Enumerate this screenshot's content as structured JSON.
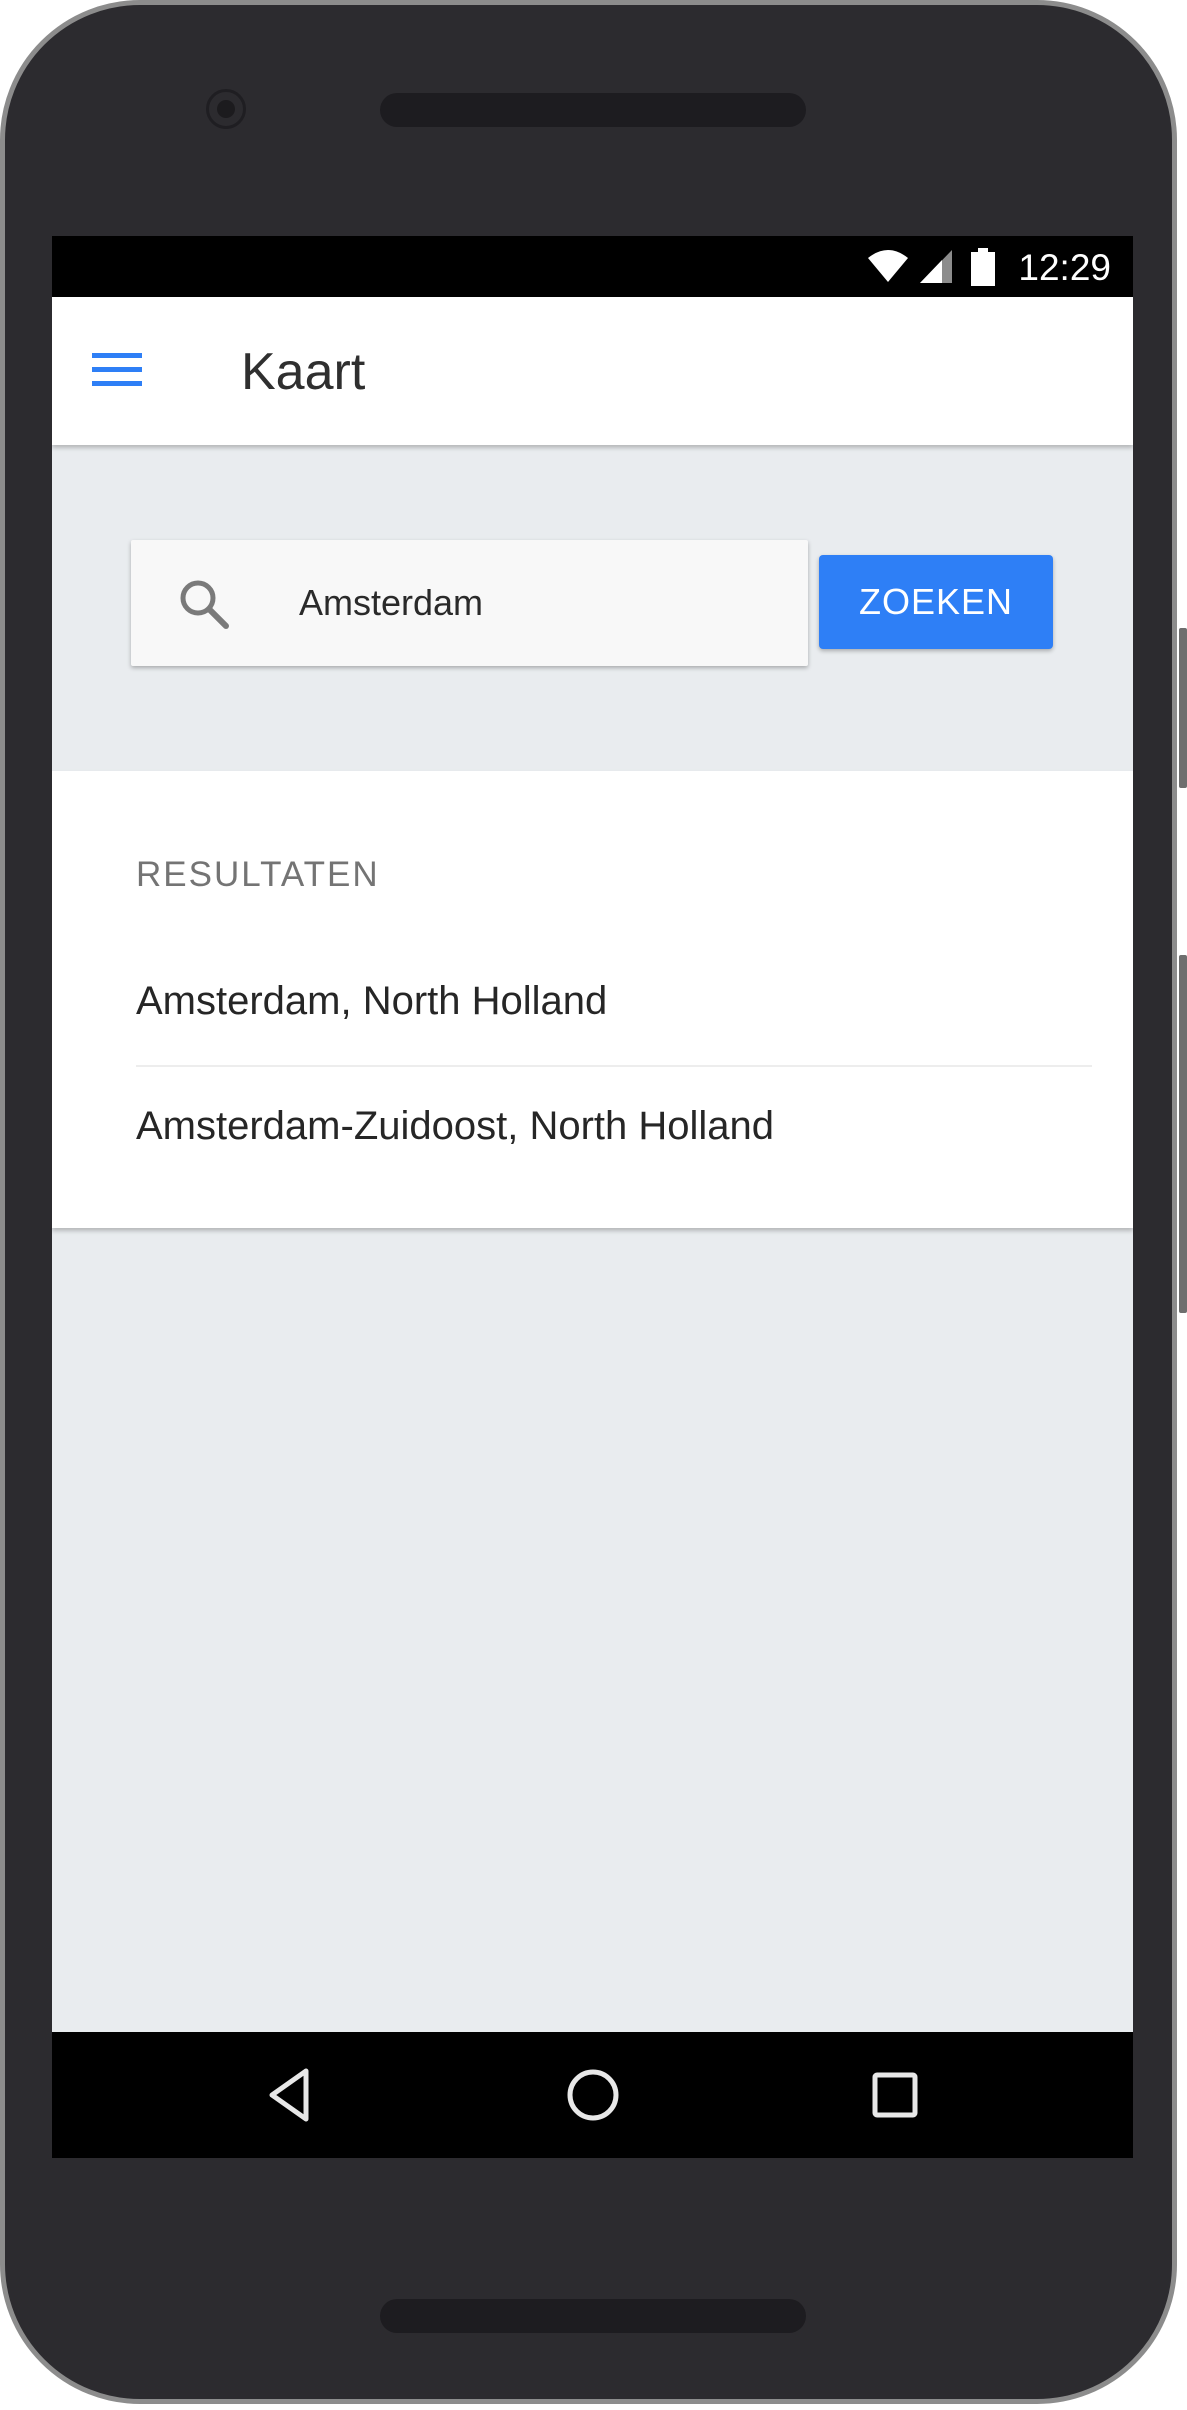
{
  "status_bar": {
    "time": "12:29",
    "icons": [
      "wifi-icon",
      "cell-signal-icon",
      "battery-icon"
    ]
  },
  "app_bar": {
    "menu_icon": "hamburger-menu-icon",
    "title": "Kaart"
  },
  "search": {
    "icon": "search-icon",
    "value": "Amsterdam",
    "button_label": "ZOEKEN"
  },
  "results": {
    "header": "RESULTATEN",
    "items": [
      {
        "label": "Amsterdam, North Holland"
      },
      {
        "label": "Amsterdam-Zuidoost, North Holland"
      }
    ]
  },
  "nav_bar": {
    "buttons": [
      "back-icon",
      "home-icon",
      "recents-icon"
    ]
  },
  "colors": {
    "accent": "#2e7ff6",
    "screen_background": "#e9ecef",
    "phone_body": "#2c2b2f"
  }
}
